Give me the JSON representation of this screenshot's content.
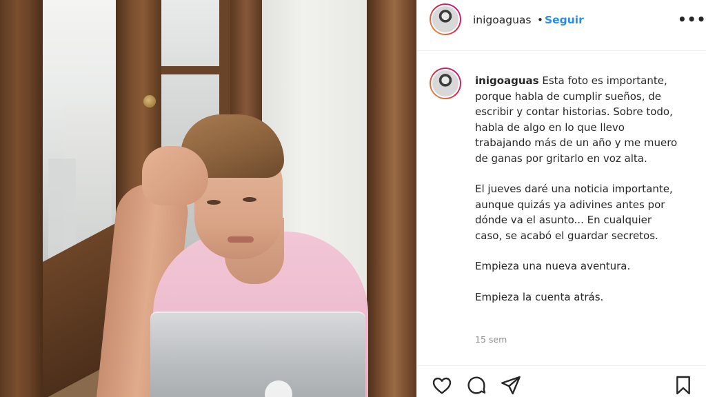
{
  "post": {
    "username": "inigoaguas",
    "separator": "•",
    "follow_label": "Seguir",
    "more_label": "•••",
    "caption": {
      "username": "inigoaguas",
      "paragraphs": [
        "Esta foto es importante, porque habla de cumplir sueños, de escribir y contar historias. Sobre todo, habla de algo en lo que llevo trabajando más de un año y me muero de ganas por gritarlo en voz alta.",
        "El jueves daré una noticia importante, aunque quizás ya adivines antes por dónde va el asunto... En cualquier caso, se acabó el guardar secretos.",
        "Empieza una nueva aventura.",
        "Empieza la cuenta atrás."
      ]
    },
    "timestamp": "15 sem",
    "actions": {
      "like_icon": "heart-icon",
      "comment_icon": "comment-icon",
      "share_icon": "paper-plane-icon",
      "save_icon": "bookmark-icon"
    }
  },
  "colors": {
    "link_blue": "#2a8fe6",
    "muted_text": "#8e8e8e",
    "text": "#262626"
  }
}
